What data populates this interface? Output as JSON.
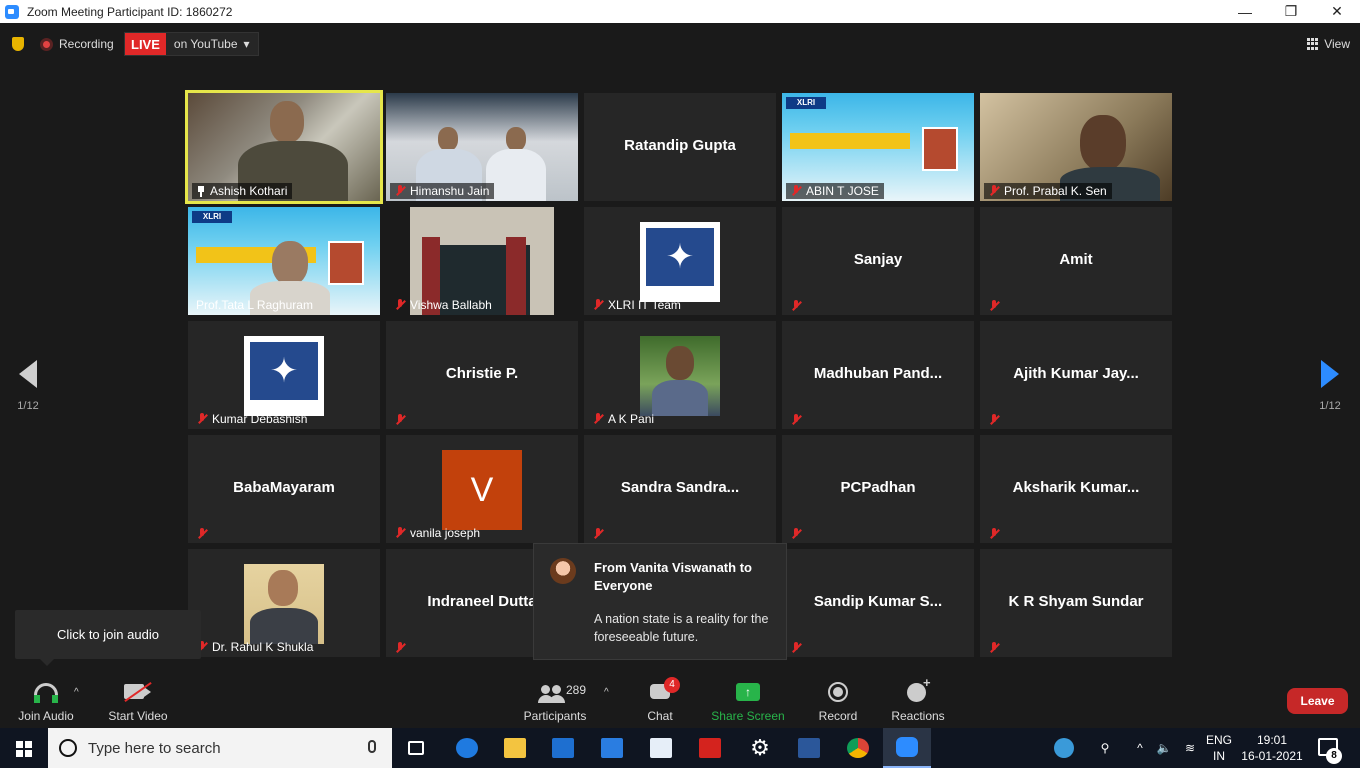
{
  "window": {
    "title": "Zoom Meeting Participant ID: 1860272",
    "minimize": "—",
    "maximize": "❐",
    "close": "✕"
  },
  "topbar": {
    "recording": "Recording",
    "live": "LIVE",
    "live_dest": "on YouTube",
    "view": "View"
  },
  "nav": {
    "page_left": "1/12",
    "page_right": "1/12"
  },
  "tiles": [
    {
      "name": "Ashish Kothari"
    },
    {
      "name": "Himanshu Jain"
    },
    {
      "name": "Ratandip Gupta"
    },
    {
      "name": "ABIN T JOSE"
    },
    {
      "name": "Prof. Prabal K. Sen"
    },
    {
      "name": "Prof.Tata L Raghuram"
    },
    {
      "name": "Vishwa Ballabh"
    },
    {
      "name": "XLRI IT Team"
    },
    {
      "name": "Sanjay"
    },
    {
      "name": "Amit"
    },
    {
      "name": "Kumar Debashish"
    },
    {
      "name": "Christie P."
    },
    {
      "name": "A K Pani"
    },
    {
      "name": "Madhuban  Pand..."
    },
    {
      "name": "Ajith Kumar Jay..."
    },
    {
      "name": "BabaMayaram"
    },
    {
      "name": "vanila joseph",
      "initial": "V",
      "avatar_color": "#c2410c"
    },
    {
      "name": "Sandra   Sandra..."
    },
    {
      "name": "PCPadhan"
    },
    {
      "name": "Aksharik  Kumar..."
    },
    {
      "name": "Dr. Rahul K Shukla"
    },
    {
      "name": "Indraneel Dutta"
    },
    {
      "name": "Sandip  Kumar  S..."
    },
    {
      "name": "K R Shyam Sundar"
    }
  ],
  "tooltip": {
    "text": "Click to join audio"
  },
  "chat_popup": {
    "from": "From Vanita Viswanath to Everyone",
    "message": "A nation state is a reality for the foreseeable future."
  },
  "toolbar": {
    "join_audio": "Join Audio",
    "start_video": "Start Video",
    "participants": "Participants",
    "participants_count": "289",
    "chat": "Chat",
    "chat_badge": "4",
    "share_screen": "Share Screen",
    "record": "Record",
    "reactions": "Reactions",
    "leave": "Leave"
  },
  "taskbar": {
    "search_placeholder": "Type here to search",
    "lang_line1": "ENG",
    "lang_line2": "IN",
    "time": "19:01",
    "date": "16-01-2021",
    "notif_count": "8"
  },
  "colors": {
    "accent": "#2d8cff",
    "live": "#e02828",
    "share": "#28b44a",
    "leave": "#c62828",
    "active_speaker": "#e6e64a"
  }
}
